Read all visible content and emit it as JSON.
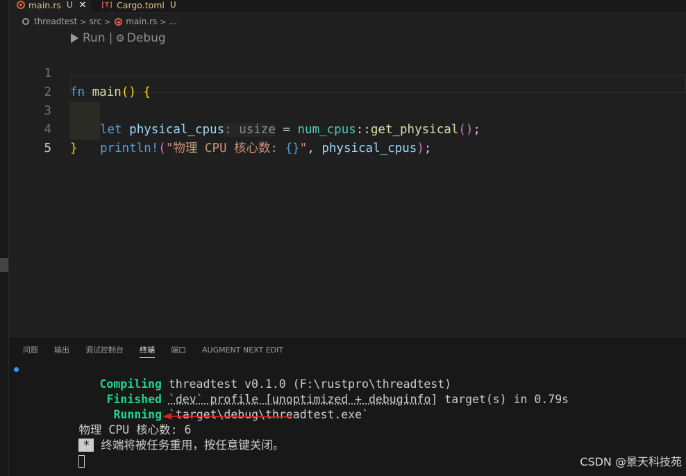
{
  "tabs": [
    {
      "label": "main.rs",
      "status": "U"
    },
    {
      "label": "Cargo.toml",
      "status": "U"
    }
  ],
  "breadcrumb": [
    "threadtest",
    "src",
    "main.rs",
    "..."
  ],
  "codelens": {
    "run": "Run",
    "sep": "|",
    "debug": "Debug"
  },
  "code": {
    "line_numbers": [
      "1",
      "2",
      "3",
      "4",
      "5"
    ],
    "l1": {
      "kw": "fn",
      "name": "main",
      "open": "()",
      "brace": "{"
    },
    "l2": {
      "kw": "let",
      "var": "physical_cpus",
      "hint": ": usize",
      "eq": " = ",
      "crate": "num_cpus",
      "path": "::",
      "fn": "get_physical",
      "call": "()",
      "semi": ";"
    },
    "l3": {
      "macro": "println!",
      "open": "(",
      "str_a": "\"物理 CPU 核心数: ",
      "fmt": "{}",
      "str_b": "\"",
      "comma": ", ",
      "arg": "physical_cpus",
      "close": ")",
      "semi": ";"
    },
    "l4": {
      "brace": "}"
    }
  },
  "panel": {
    "tabs": [
      "问题",
      "输出",
      "调试控制台",
      "终端",
      "端口",
      "AUGMENT NEXT EDIT"
    ],
    "active_tab": "终端"
  },
  "terminal": {
    "l1": {
      "status": "Compiling",
      "rest": " threadtest v0.1.0 (F:\\rustpro\\threadtest)"
    },
    "l2": {
      "status": "Finished",
      "sp": " ",
      "profile": "`dev` profile [unoptimized + debuginfo]",
      "rest": " target(s) in 0.79s"
    },
    "l3": {
      "status": "Running",
      "rest": " `target\\debug\\threadtest.exe`"
    },
    "l4": "物理 CPU 核心数: 6",
    "l5": {
      "star": "*",
      "text": "终端将被任务重用，按任意键关闭。"
    }
  },
  "watermark": "CSDN @景天科技苑",
  "colors": {
    "accent": "#3794ff",
    "arrow": "#e02020",
    "success": "#23d18b"
  }
}
